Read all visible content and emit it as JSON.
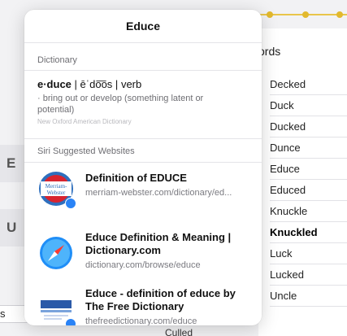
{
  "background": {
    "words_header": "ords",
    "words": [
      {
        "text": "Decked",
        "bold": false
      },
      {
        "text": "Duck",
        "bold": false
      },
      {
        "text": "Ducked",
        "bold": false
      },
      {
        "text": "Dunce",
        "bold": false
      },
      {
        "text": "Educe",
        "bold": false
      },
      {
        "text": "Educed",
        "bold": false
      },
      {
        "text": "Knuckle",
        "bold": false
      },
      {
        "text": "Knuckled",
        "bold": true
      },
      {
        "text": "Luck",
        "bold": false
      },
      {
        "text": "Lucked",
        "bold": false
      },
      {
        "text": "Uncle",
        "bold": false
      }
    ],
    "left_tile_e": "E",
    "left_tile_u": "U",
    "left_bottom_label": "s",
    "under_popover_text": "Culled",
    "accent_color": "#e2b92e"
  },
  "popover": {
    "title": "Educe",
    "dictionary_label": "Dictionary",
    "dictionary": {
      "headword": "e·duce",
      "pronunciation": "ēˈdo͞os",
      "pos": "verb",
      "separator": "|",
      "definition": "· bring out or develop (something latent or potential)",
      "source": "New Oxford American Dictionary"
    },
    "siri_label": "Siri Suggested Websites",
    "websites": [
      {
        "icon": "merriam-webster-logo-icon",
        "title": "Definition of EDUCE",
        "url": "merriam-webster.com/dictionary/ed..."
      },
      {
        "icon": "safari-compass-icon",
        "title": "Educe Definition & Meaning | Dictionary.com",
        "url": "dictionary.com/browse/educe"
      },
      {
        "icon": "free-dictionary-logo-icon",
        "title": "Educe - definition of educe by The Free Dictionary",
        "url": "thefreedictionary.com/educe"
      }
    ]
  }
}
